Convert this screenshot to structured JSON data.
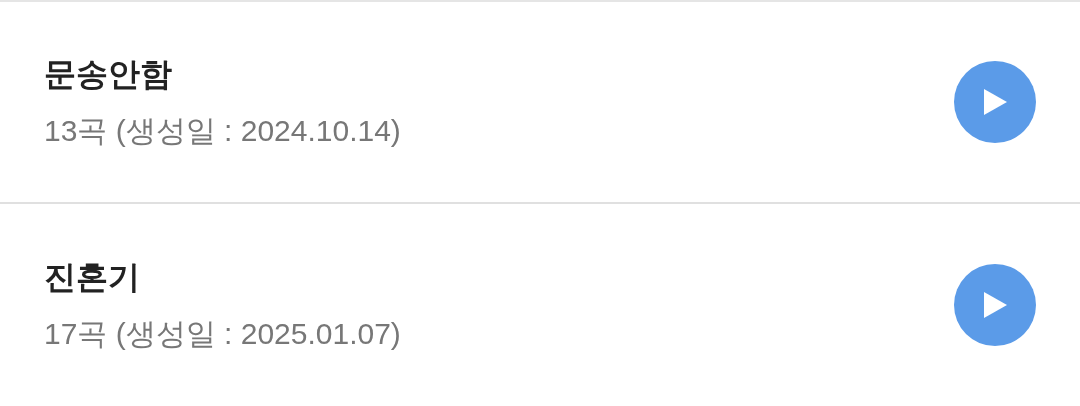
{
  "playlists": [
    {
      "title": "문송안함",
      "subtitle": "13곡 (생성일 : 2024.10.14)"
    },
    {
      "title": "진혼기",
      "subtitle": "17곡 (생성일 : 2025.01.07)"
    }
  ]
}
